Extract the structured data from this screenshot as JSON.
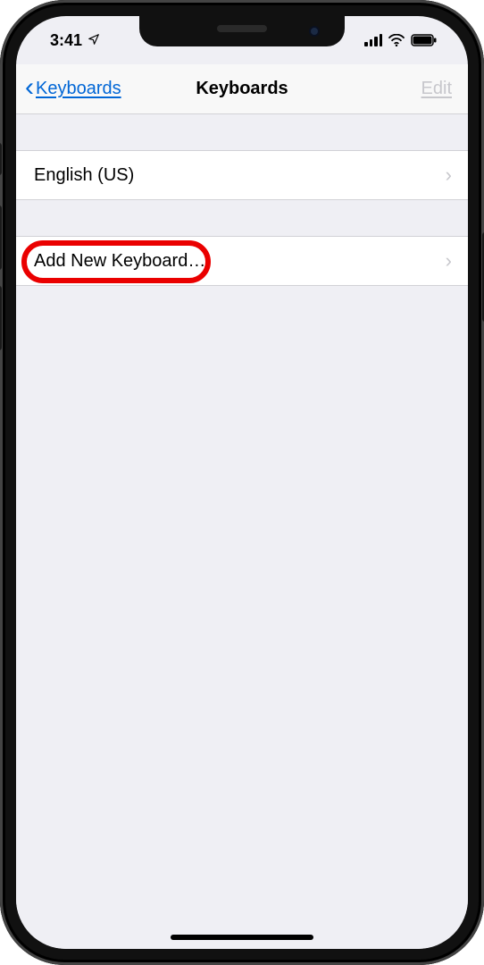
{
  "statusbar": {
    "time": "3:41"
  },
  "navbar": {
    "back_label": "Keyboards",
    "title": "Keyboards",
    "edit_label": "Edit"
  },
  "groups": {
    "keyboards": {
      "item0": "English (US)"
    },
    "actions": {
      "add_label": "Add New Keyboard…"
    }
  }
}
